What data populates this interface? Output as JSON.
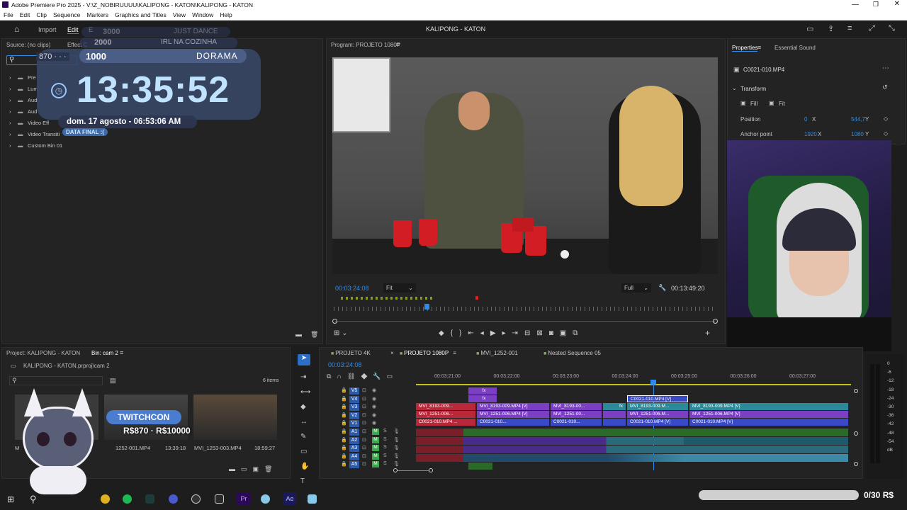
{
  "app": {
    "window_title": "Adobe Premiere Pro 2025 - V:\\Z_NOBIRUUUU\\KALIPONG - KATON\\KALIPONG - KATON",
    "sequence_title": "KALIPONG - KATON"
  },
  "menu": [
    "File",
    "Edit",
    "Clip",
    "Sequence",
    "Markers",
    "Graphics and Titles",
    "View",
    "Window",
    "Help"
  ],
  "workspace": {
    "home_label": "",
    "import": "Import",
    "edit": "Edit",
    "export": "E"
  },
  "overlay": {
    "goal1": {
      "value": "3000",
      "label": "JUST DANCE"
    },
    "goal2": {
      "value": "2000",
      "label": "IRL NA COZINHA"
    },
    "goal3": {
      "value": "1000",
      "label": "DORAMA"
    },
    "small_value": "870 · · ·",
    "clock": "13:35:52",
    "date": "dom. 17 agosto - 06:53:06 AM",
    "date_badge": "DATA FINAL :(",
    "twitchcon_label": "TWITCHCON",
    "twitchcon_amount": "R$870 · R$10000",
    "bottom_bar_text": "0/30 R$"
  },
  "source_panel": {
    "tab_source": "Source: (no clips)",
    "tab_effect": "Effect C",
    "items": [
      "Pre",
      "Lum",
      "Aud",
      "Aud",
      "Video Eff",
      "Video Transiti",
      "Custom Bin 01"
    ]
  },
  "program": {
    "tab": "Program: PROJETO 1080P",
    "timecode": "00:03:24:08",
    "fit": "Fit",
    "quality": "Full",
    "duration": "00:13:49:20"
  },
  "properties": {
    "tab_properties": "Properties",
    "tab_essential": "Essential Sound",
    "clip_name": "C0021-010.MP4",
    "section": "Transform",
    "fill": "Fill",
    "fit": "Fit",
    "position_label": "Position",
    "position_x": "0",
    "position_x_unit": "X",
    "position_y": "544,7",
    "position_y_unit": "Y",
    "anchor_label": "Anchor point",
    "anchor_x": "1920",
    "anchor_x_unit": "X",
    "anchor_y": "1080",
    "anchor_y_unit": "Y"
  },
  "project": {
    "tab": "Project: KALIPONG - KATON",
    "bin_tab": "Bin: cam 2",
    "path": "KALIPONG - KATON.prproj\\cam 2",
    "count": "6 items",
    "thumbs": [
      {
        "name": "M",
        "dur": ""
      },
      {
        "name": "1252-001.MP4",
        "dur": "13:39:18"
      },
      {
        "name": "MVI_1253-003.MP4",
        "dur": "18:59:27"
      }
    ]
  },
  "timeline": {
    "tabs": [
      "PROJETO 4K",
      "PROJETO 1080P",
      "MVI_1252-001",
      "Nested Sequence 05"
    ],
    "timecode": "00:03:24:08",
    "ruler": [
      "00:03:21:00",
      "00:03:22:00",
      "00:03:23:00",
      "00:03:24:00",
      "00:03:25:00",
      "00:03:26:00",
      "00:03:27:00"
    ],
    "video_tracks": [
      "V5",
      "V4",
      "V3",
      "V2",
      "V1"
    ],
    "audio_tracks": [
      "A1",
      "A2",
      "A3",
      "A4",
      "A5"
    ],
    "clips": {
      "v3": [
        "MVI_8193-009...",
        "MVI_8193-009.MP4 [V]",
        "MVI_8193-00...",
        "MVI_8193-009.M...",
        "MVI_8193-009.MP4 [V]"
      ],
      "v2": [
        "MVI_1251-006...",
        "MVI_1251-006.MP4 [V]",
        "MVI_1251-00...",
        "MVI_1251-006.M...",
        "MVI_1251-006.MP4 [V]"
      ],
      "v1": [
        "C0021-010.MP4 ...",
        "C0021-010...",
        "C0021-010...",
        "C0021-010.MP4 [V]",
        "C0021-010.MP4 [V]"
      ],
      "v4": "C0021-010.MP4 [V]",
      "fx": "fx"
    },
    "meter_labels": [
      "0",
      "-6",
      "-12",
      "-18",
      "-24",
      "-30",
      "-36",
      "-42",
      "-48",
      "-54",
      "dB"
    ],
    "meter_bottom": [
      "S",
      "S"
    ]
  },
  "colors": {
    "accent": "#2d8ceb",
    "clip_purple": "#7a3fc2",
    "clip_teal": "#2a8a9a",
    "clip_blue": "#3a49c8",
    "clip_red": "#b8283a",
    "audio_green": "#2c6a2a"
  }
}
